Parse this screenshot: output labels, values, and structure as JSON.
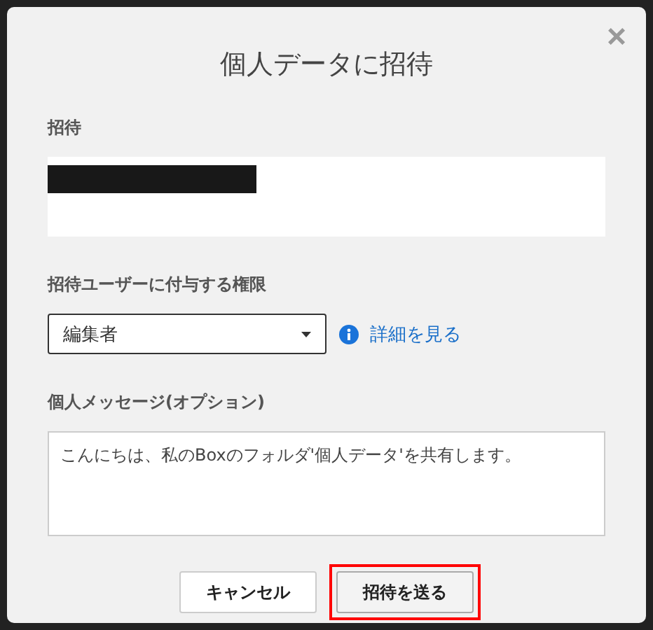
{
  "dialog": {
    "title": "個人データに招待",
    "close": "×"
  },
  "invite": {
    "label": "招待",
    "redacted": true
  },
  "permission": {
    "label": "招待ユーザーに付与する権限",
    "value": "編集者",
    "link": "詳細を見る"
  },
  "message": {
    "label": "個人メッセージ(オプション)",
    "value": "こんにちは、私のBoxのフォルダ'個人データ'を共有します。"
  },
  "buttons": [
    {
      "label": "キャンセル",
      "kind": "secondary",
      "highlighted": false
    },
    {
      "label": "招待を送る",
      "kind": "primary",
      "highlighted": true
    }
  ]
}
